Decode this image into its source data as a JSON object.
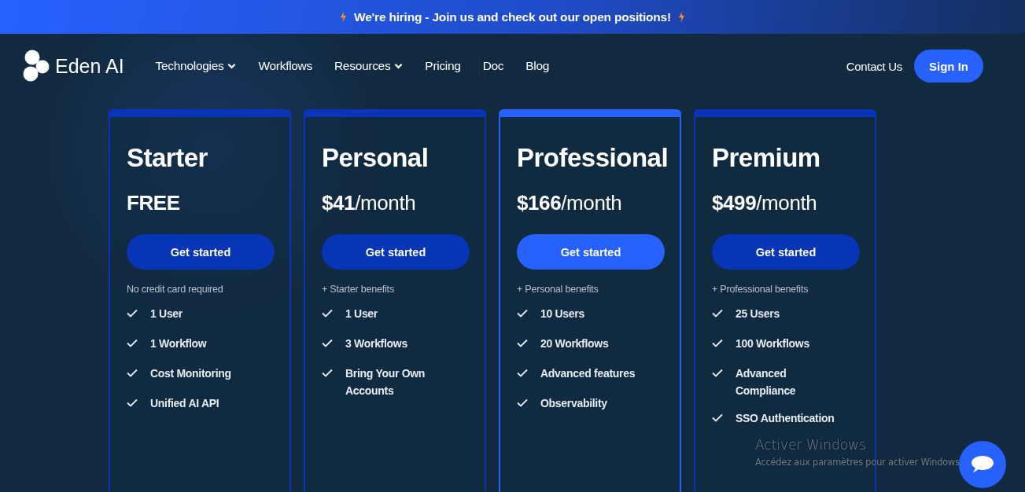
{
  "banner": {
    "text": "We're hiring - Join us and check out our open positions!"
  },
  "nav": {
    "brand": "Eden AI",
    "items": [
      {
        "label": "Technologies",
        "has_menu": true
      },
      {
        "label": "Workflows",
        "has_menu": false
      },
      {
        "label": "Resources",
        "has_menu": true
      },
      {
        "label": "Pricing",
        "has_menu": false
      },
      {
        "label": "Doc",
        "has_menu": false
      },
      {
        "label": "Blog",
        "has_menu": false
      }
    ],
    "contact": "Contact Us",
    "sign_in": "Sign In"
  },
  "plans": [
    {
      "name": "Starter",
      "price": {
        "kind": "free",
        "text": "FREE"
      },
      "button": "Get started",
      "highlighted": false,
      "note": "No credit card required",
      "features": [
        "1 User",
        "1 Workflow",
        "Cost Monitoring",
        "Unified AI API"
      ]
    },
    {
      "name": "Personal",
      "price": {
        "kind": "rate",
        "text": "**$41**/month"
      },
      "button": "Get started",
      "highlighted": false,
      "note": "+ Starter benefits",
      "features": [
        "1 User",
        "3 Workflows",
        "Bring Your Own Accounts"
      ]
    },
    {
      "name": "Professional",
      "price": {
        "kind": "rate",
        "text": "**$166**/month"
      },
      "button": "Get started",
      "highlighted": true,
      "note": "+ Personal benefits",
      "features": [
        "10 Users",
        "20 Workflows",
        "Advanced features",
        "Observability"
      ]
    },
    {
      "name": "Premium",
      "price": {
        "kind": "rate",
        "text": "**$499**/month"
      },
      "button": "Get started",
      "highlighted": false,
      "note": "+ Professional benefits",
      "features": [
        "25 Users",
        "100 Workflows",
        "Advanced Compliance",
        "SSO Authentication"
      ]
    }
  ],
  "os_watermark": {
    "title": "Activer Windows",
    "subtitle": "Accédez aux paramètres pour activer Windows."
  }
}
